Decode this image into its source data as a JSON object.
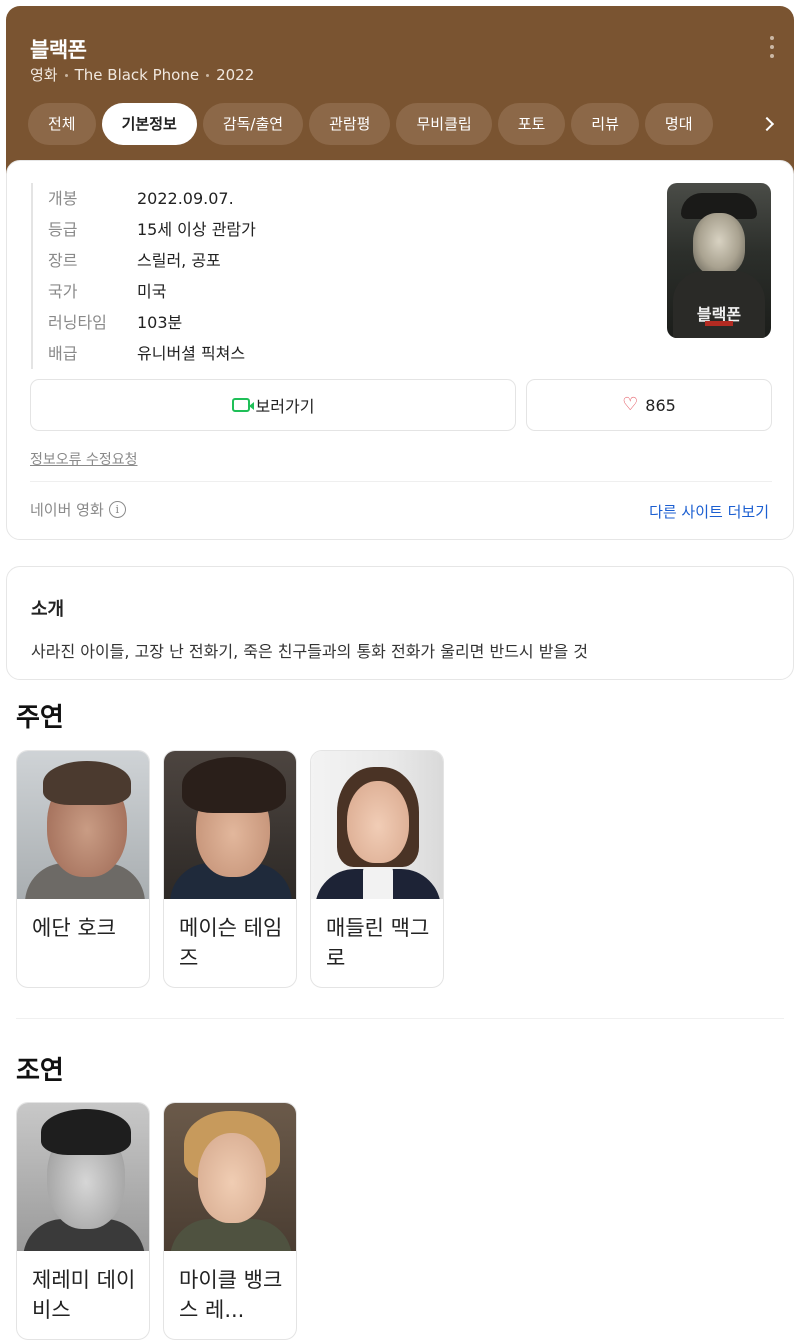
{
  "header": {
    "title": "블랙폰",
    "meta": [
      "영화",
      "The Black Phone",
      "2022"
    ]
  },
  "tabs": [
    {
      "label": "전체",
      "active": false
    },
    {
      "label": "기본정보",
      "active": true
    },
    {
      "label": "감독/출연",
      "active": false
    },
    {
      "label": "관람평",
      "active": false
    },
    {
      "label": "무비클립",
      "active": false
    },
    {
      "label": "포토",
      "active": false
    },
    {
      "label": "리뷰",
      "active": false
    },
    {
      "label": "명대",
      "active": false
    }
  ],
  "info": {
    "rows": [
      {
        "key": "개봉",
        "value": "2022.09.07."
      },
      {
        "key": "등급",
        "value": "15세 이상 관람가"
      },
      {
        "key": "장르",
        "value": "스릴러, 공포"
      },
      {
        "key": "국가",
        "value": "미국"
      },
      {
        "key": "러닝타임",
        "value": "103분"
      },
      {
        "key": "배급",
        "value": "유니버셜 픽쳐스"
      }
    ],
    "poster_title": "블랙폰",
    "watch_label": "보러가기",
    "like_count": "865",
    "report_link": "정보오류 수정요청",
    "source": "네이버 영화",
    "more_sites": "다른 사이트 더보기",
    "accent_green": "#1fbf58",
    "accent_heart": "#e04651",
    "header_color": "#7a5431"
  },
  "intro": {
    "title": "소개",
    "text": "사라진 아이들, 고장 난 전화기, 죽은 친구들과의 통화 전화가 울리면 반드시 받을 것"
  },
  "cast": {
    "main_title": "주연",
    "main": [
      {
        "name": "에단 호크"
      },
      {
        "name": "메이슨 테임즈"
      },
      {
        "name": "매들린 맥그로"
      }
    ],
    "supporting_title": "조연",
    "supporting": [
      {
        "name": "제레미 데이비스"
      },
      {
        "name": "마이클 뱅크스 레..."
      }
    ]
  }
}
